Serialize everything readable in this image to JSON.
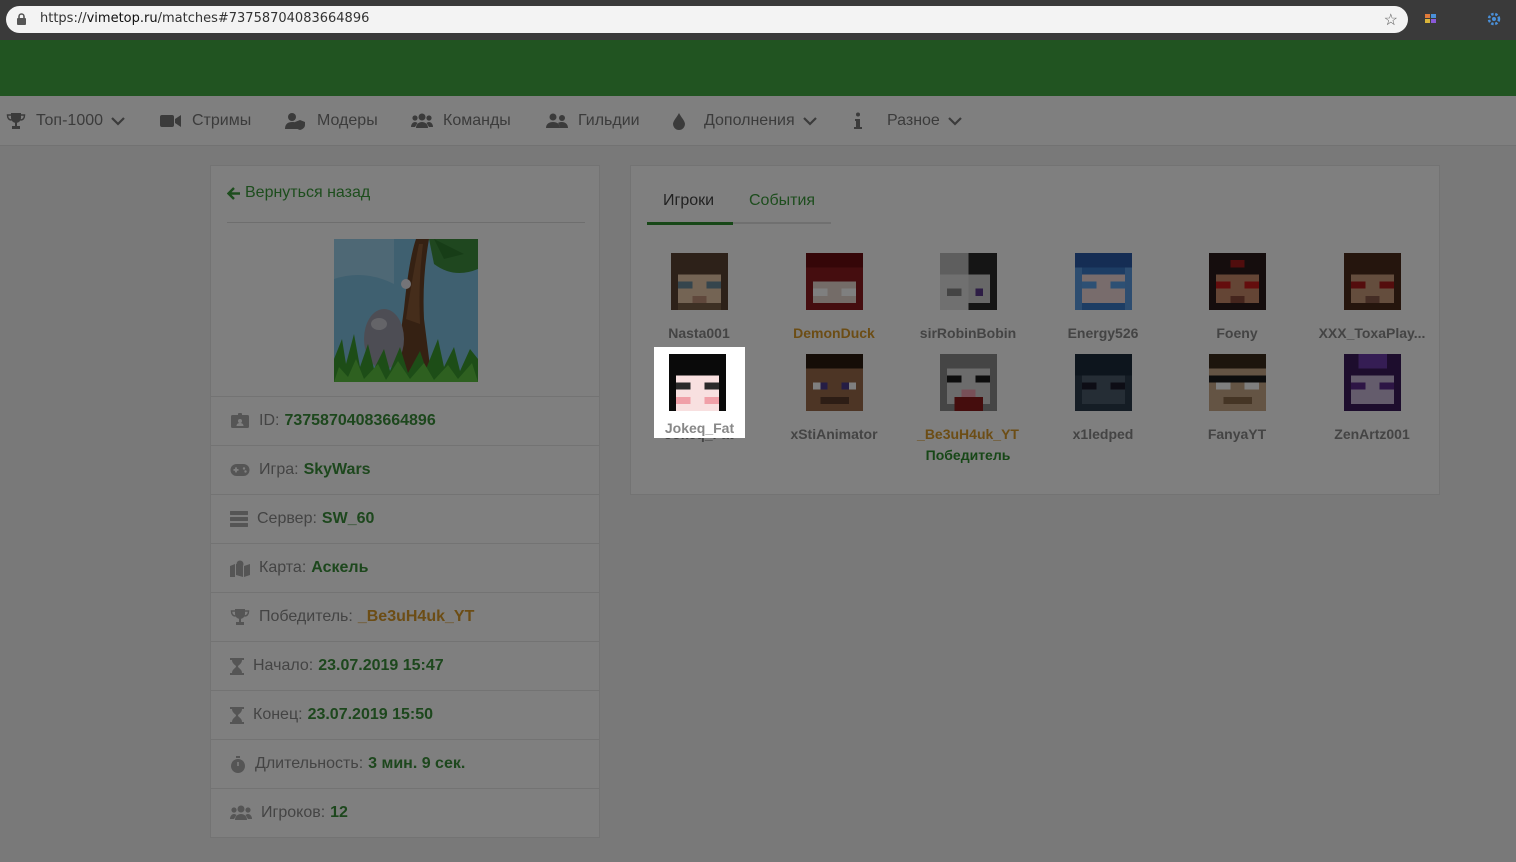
{
  "browser": {
    "url_prefix": "https://",
    "url_host": "vimetop.ru",
    "url_path": "/matches#73758704083664896"
  },
  "nav": {
    "items": [
      {
        "label": "Топ-1000",
        "icon": "trophy-icon",
        "dropdown": true
      },
      {
        "label": "Стримы",
        "icon": "video-camera-icon",
        "dropdown": false
      },
      {
        "label": "Модеры",
        "icon": "user-shield-icon",
        "dropdown": false
      },
      {
        "label": "Команды",
        "icon": "users-icon",
        "dropdown": false
      },
      {
        "label": "Гильдии",
        "icon": "user-friends-icon",
        "dropdown": false
      },
      {
        "label": "Дополнения",
        "icon": "drop-icon",
        "dropdown": true
      },
      {
        "label": "Разное",
        "icon": "info-icon",
        "dropdown": true
      }
    ]
  },
  "match": {
    "back_label": "Вернуться назад",
    "rows": [
      {
        "label": "ID:",
        "value": "73758704083664896",
        "icon": "id-card-icon"
      },
      {
        "label": "Игра:",
        "value": "SkyWars",
        "icon": "gamepad-icon"
      },
      {
        "label": "Сервер:",
        "value": "SW_60",
        "icon": "server-icon"
      },
      {
        "label": "Карта:",
        "value": "Аскель",
        "icon": "map-icon"
      },
      {
        "label": "Победитель:",
        "value": "_Be3uH4uk_YT",
        "icon": "trophy-icon"
      },
      {
        "label": "Начало:",
        "value": "23.07.2019 15:47",
        "icon": "hourglass-start-icon"
      },
      {
        "label": "Конец:",
        "value": "23.07.2019 15:50",
        "icon": "hourglass-end-icon"
      },
      {
        "label": "Длительность:",
        "value": "3 мин. 9 сек.",
        "icon": "stopwatch-icon"
      },
      {
        "label": "Игроков:",
        "value": "12",
        "icon": "users-icon"
      }
    ]
  },
  "tabs": {
    "players": "Игроки",
    "events": "События"
  },
  "players": [
    {
      "name": "Nasta001"
    },
    {
      "name": "DemonDuck",
      "highlight": "gold"
    },
    {
      "name": "sirRobinBobin"
    },
    {
      "name": "Energy526"
    },
    {
      "name": "Foeny"
    },
    {
      "name": "XXX_ToxaPlay..."
    },
    {
      "name": "Jokeq_Fat"
    },
    {
      "name": "xStiAnimator"
    },
    {
      "name": "_Be3uH4uk_YT",
      "highlight": "gold",
      "badge": "Победитель"
    },
    {
      "name": "x1ledped"
    },
    {
      "name": "FanyaYT"
    },
    {
      "name": "ZenArtz001"
    }
  ],
  "colors": {
    "brand_green": "#43a843",
    "link_green": "#3a9a3a",
    "winner_gold": "#d99a2b"
  }
}
